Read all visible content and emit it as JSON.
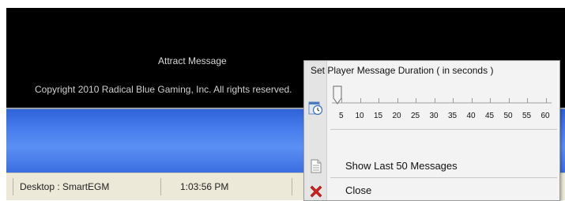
{
  "attract": {
    "title": "Attract Message",
    "copyright": "Copyright 2010 Radical Blue Gaming, Inc. All rights reserved."
  },
  "statusbar": {
    "desktop": "Desktop : SmartEGM",
    "time": "1:03:56 PM"
  },
  "menu": {
    "slider": {
      "label": "Set Player Message Duration ( in seconds )",
      "ticks": [
        "5",
        "10",
        "15",
        "20",
        "25",
        "30",
        "35",
        "40",
        "45",
        "50",
        "55",
        "60"
      ],
      "value": 5
    },
    "items": [
      {
        "label": "Show Last 50 Messages",
        "icon": "document-icon"
      },
      {
        "label": "Close",
        "icon": "close-x-icon"
      }
    ]
  },
  "colors": {
    "taskbar_blue": "#4a80ee",
    "attract_bg": "#000000",
    "close_icon": "#d42020"
  }
}
